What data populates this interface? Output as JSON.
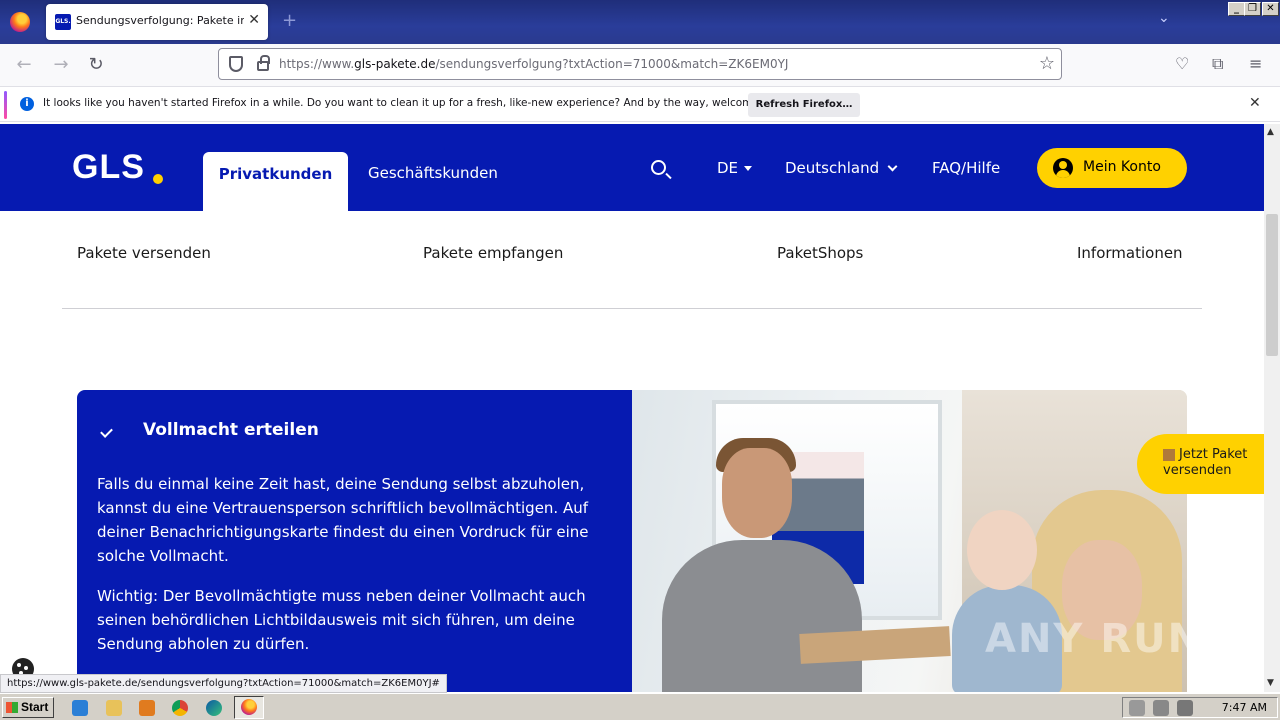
{
  "browser": {
    "tab_title": "Sendungsverfolgung: Pakete im",
    "tab_favicon": "GLS.",
    "url_prefix": "https://www.",
    "url_domain": "gls-pakete.de",
    "url_path": "/sendungsverfolgung?txtAction=71000&match=ZK6EM0YJ",
    "notification_text": "It looks like you haven't started Firefox in a while. Do you want to clean it up for a fresh, like-new experience? And by the way, welcome back!",
    "notification_button": "Refresh Firefox…",
    "status_url": "https://www.gls-pakete.de/sendungsverfolgung?txtAction=71000&match=ZK6EM0YJ#"
  },
  "header": {
    "logo": "GLS",
    "tab_private": "Privatkunden",
    "tab_business": "Geschäftskunden",
    "language": "DE",
    "country": "Deutschland",
    "faq": "FAQ/Hilfe",
    "account": "Mein Konto"
  },
  "subnav": {
    "items": [
      "Pakete versenden",
      "Pakete empfangen",
      "PaketShops",
      "Informationen"
    ]
  },
  "card": {
    "title": "Vollmacht erteilen",
    "paragraph1": "Falls du einmal keine Zeit hast, deine Sendung selbst abzuholen, kannst du eine Vertrauensperson schriftlich bevollmächtigen. Auf deiner Benachrichtigungskarte findest du einen Vordruck für eine solche Vollmacht.",
    "paragraph2": "Wichtig: Der Bevollmächtigte muss neben deiner Vollmacht auch seinen behördlichen Lichtbildausweis mit sich führen, um deine Sendung abholen zu dürfen."
  },
  "floating_button": "Jetzt Paket versenden",
  "watermark": "ANY RUN",
  "taskbar": {
    "start": "Start",
    "clock": "7:47 AM"
  },
  "colors": {
    "gls_blue": "#061ab1",
    "gls_yellow": "#ffd100"
  }
}
